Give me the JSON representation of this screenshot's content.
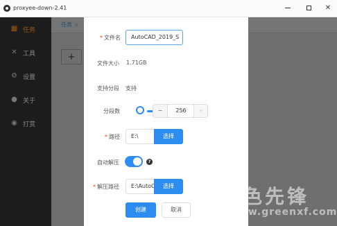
{
  "window": {
    "title": "proxyee-down-2.41",
    "controls": {
      "minimize": "minimize",
      "maximize": "maximize",
      "close": "✕"
    }
  },
  "sidebar": {
    "items": [
      {
        "label": "任务",
        "icon": "grid-icon",
        "active": true
      },
      {
        "label": "工具",
        "icon": "tools-icon",
        "active": false
      },
      {
        "label": "设置",
        "icon": "gear-icon",
        "active": false
      },
      {
        "label": "关于",
        "icon": "info-icon",
        "active": false
      },
      {
        "label": "打赏",
        "icon": "gift-icon",
        "active": false
      }
    ]
  },
  "tabs": [
    {
      "label": "任务",
      "close": "×"
    }
  ],
  "main": {
    "add_button": "+"
  },
  "dialog": {
    "filename": {
      "label": "文件名",
      "value": "AutoCAD_2019_S"
    },
    "filesize": {
      "label": "文件大小",
      "value": "1.71GB"
    },
    "support_segment": {
      "label": "支持分段",
      "value": "支持"
    },
    "segments": {
      "label": "分段数",
      "value": "256",
      "minus": "−",
      "plus": "+"
    },
    "path": {
      "label": "路径",
      "value": "E:\\",
      "button": "选择"
    },
    "auto_unzip": {
      "label": "自动解压",
      "enabled": true,
      "help": "?"
    },
    "unzip_path": {
      "label": "解压路径",
      "value": "E:\\AutoCAD",
      "button": "选择"
    },
    "actions": {
      "create": "创建",
      "cancel": "取消"
    }
  },
  "watermark": {
    "text": "绿色先锋",
    "url": "www.greenxf.com"
  },
  "colors": {
    "primary": "#2d8cf0",
    "required": "#ed4014",
    "sidebar_bg": "#1c1c1c"
  }
}
